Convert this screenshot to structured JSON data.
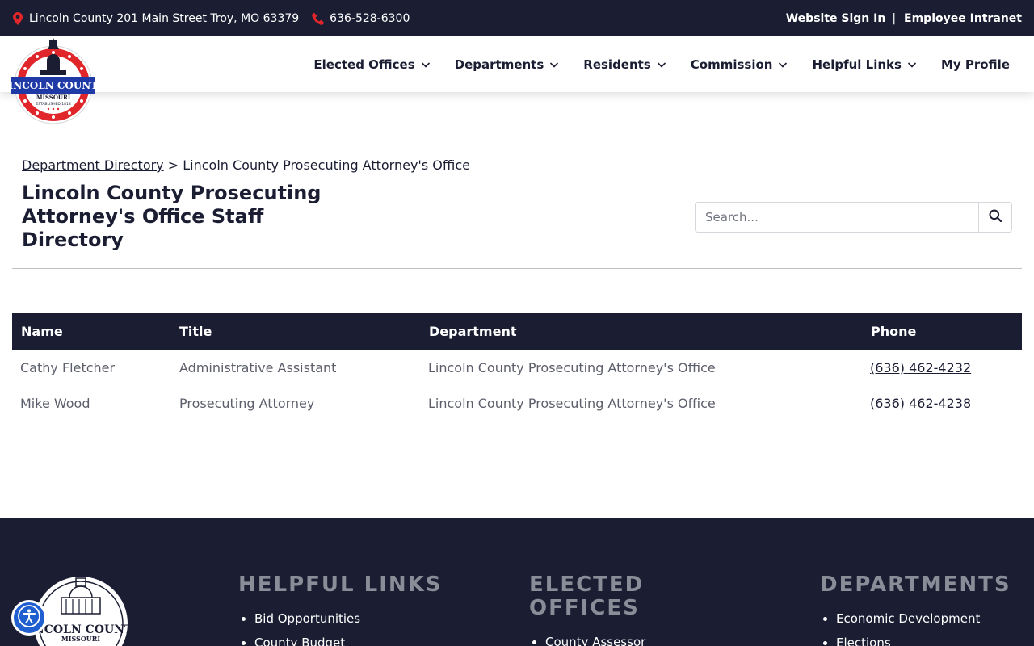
{
  "topbar": {
    "address": "Lincoln County 201 Main Street Troy, MO 63379",
    "phone": "636-528-6300",
    "sign_in": "Website Sign In",
    "separator": "|",
    "intranet": "Employee Intranet",
    "icons": [
      "map-pin-icon",
      "phone-icon"
    ]
  },
  "logo": {
    "name": "LINCOLN COUNTY",
    "state": "MISSOURI",
    "established": "ESTABLISHED 1818"
  },
  "nav": {
    "items": [
      {
        "label": "Elected Offices",
        "has_dropdown": true
      },
      {
        "label": "Departments",
        "has_dropdown": true
      },
      {
        "label": "Residents",
        "has_dropdown": true
      },
      {
        "label": "Commission",
        "has_dropdown": true
      },
      {
        "label": "Helpful Links",
        "has_dropdown": true
      },
      {
        "label": "My Profile",
        "has_dropdown": false
      }
    ]
  },
  "breadcrumb": {
    "link": "Department Directory",
    "separator": ">",
    "current": "Lincoln County Prosecuting Attorney's Office"
  },
  "page": {
    "title": "Lincoln County Prosecuting Attorney's Office Staff Directory"
  },
  "search": {
    "placeholder": "Search...",
    "value": ""
  },
  "table": {
    "headers": {
      "name": "Name",
      "title": "Title",
      "department": "Department",
      "phone": "Phone"
    },
    "rows": [
      {
        "name": "Cathy Fletcher",
        "title": "Administrative Assistant",
        "department": "Lincoln County Prosecuting Attorney's Office",
        "phone": "(636) 462-4232"
      },
      {
        "name": "Mike Wood",
        "title": "Prosecuting Attorney",
        "department": "Lincoln County Prosecuting Attorney's Office",
        "phone": "(636) 462-4238"
      }
    ]
  },
  "footer": {
    "logo_name": "LINCOLN COUNTY",
    "logo_state": "MISSOURI",
    "helpful_links": {
      "heading": "HELPFUL LINKS",
      "items": [
        "Bid Opportunities",
        "County Budget"
      ]
    },
    "elected_offices": {
      "heading": "ELECTED OFFICES",
      "items": [
        "County Assessor"
      ]
    },
    "departments": {
      "heading": "DEPARTMENTS",
      "items": [
        "Economic Development",
        "Elections"
      ]
    }
  },
  "colors": {
    "navy": "#1b1e33",
    "accent_red": "#e0262b",
    "logo_blue": "#1f3aa6",
    "footer_heading": "#8a8c97",
    "a11y_blue": "#1f5fcf"
  }
}
